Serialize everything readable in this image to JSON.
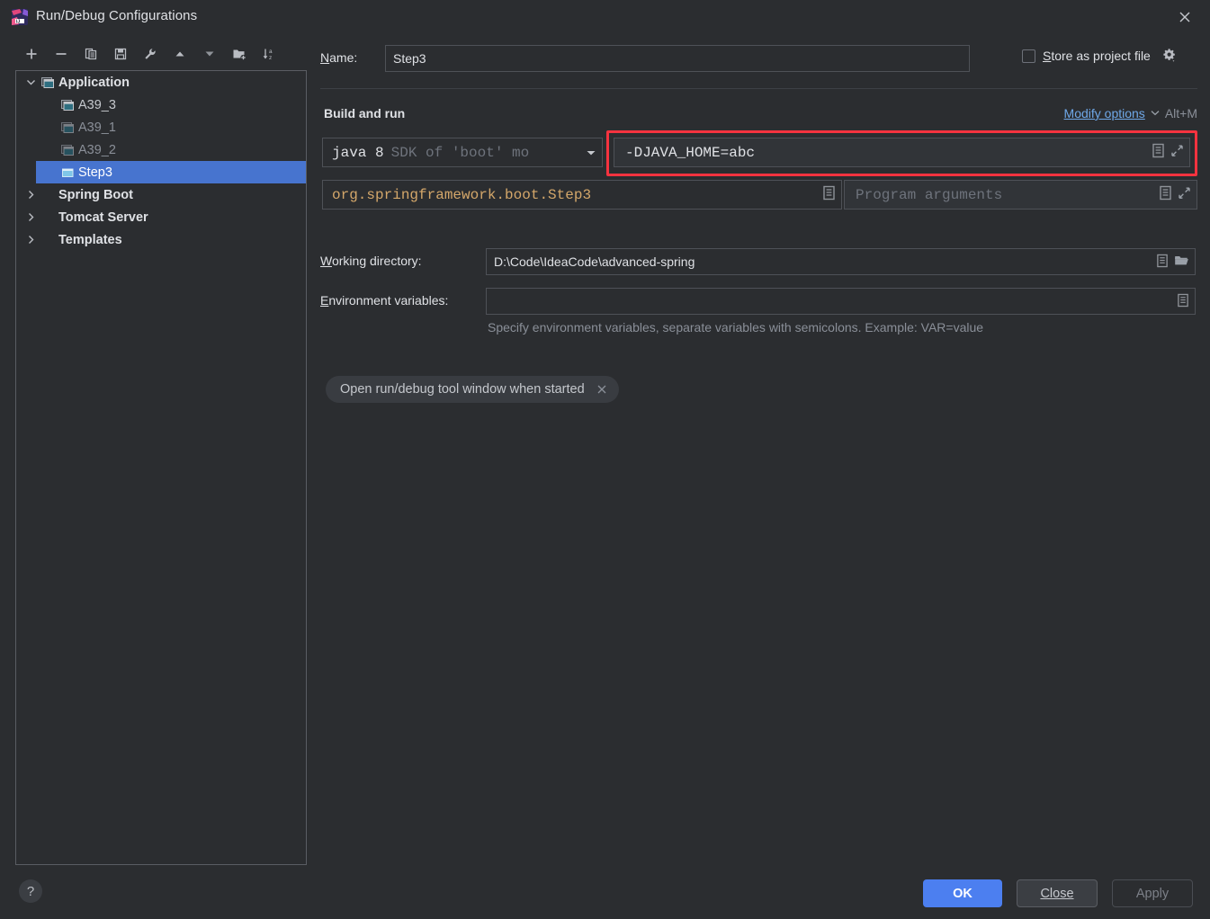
{
  "window": {
    "title": "Run/Debug Configurations",
    "logo_icon": "intellij-idea-logo",
    "close_icon": "close-icon"
  },
  "toolbar": {
    "buttons": [
      {
        "name": "add-configuration-button",
        "icon": "plus-icon"
      },
      {
        "name": "remove-configuration-button",
        "icon": "minus-icon"
      },
      {
        "name": "copy-configuration-button",
        "icon": "copy-icon"
      },
      {
        "name": "save-configuration-button",
        "icon": "save-icon"
      },
      {
        "name": "edit-templates-button",
        "icon": "wrench-icon"
      },
      {
        "name": "move-up-button",
        "icon": "arrow-up-icon"
      },
      {
        "name": "move-down-button",
        "icon": "arrow-down-icon"
      },
      {
        "name": "new-folder-button",
        "icon": "new-folder-icon"
      },
      {
        "name": "sort-configurations-button",
        "icon": "sort-az-icon"
      }
    ]
  },
  "tree": {
    "items": [
      {
        "label": "Application",
        "level": 0,
        "twisty": "expanded",
        "icon": "application-icon",
        "style": "bold",
        "selected": false
      },
      {
        "label": "A39_3",
        "level": 1,
        "twisty": "none",
        "icon": "application-icon",
        "style": "child",
        "selected": false
      },
      {
        "label": "A39_1",
        "level": 1,
        "twisty": "none",
        "icon": "application-icon-dim",
        "style": "dim",
        "selected": false
      },
      {
        "label": "A39_2",
        "level": 1,
        "twisty": "none",
        "icon": "application-icon-dim",
        "style": "dim",
        "selected": false
      },
      {
        "label": "Step3",
        "level": 1,
        "twisty": "none",
        "icon": "application-icon-sel",
        "style": "sel",
        "selected": true
      },
      {
        "label": "Spring Boot",
        "level": 0,
        "twisty": "collapsed",
        "icon": "spring-boot-icon",
        "style": "bold",
        "selected": false
      },
      {
        "label": "Tomcat Server",
        "level": 0,
        "twisty": "collapsed",
        "icon": "tomcat-icon",
        "style": "bold",
        "selected": false
      },
      {
        "label": "Templates",
        "level": 0,
        "twisty": "collapsed",
        "icon": "wrench-icon",
        "style": "bold",
        "selected": false
      }
    ]
  },
  "form": {
    "name_label": "Name:",
    "name_value": "Step3",
    "store_as_project_file_label": "Store as project file",
    "store_as_project_file_checked": false,
    "store_gear_icon": "gear-icon",
    "section_title": "Build and run",
    "modify_options_label": "Modify options",
    "modify_options_shortcut": "Alt+M",
    "jdk_primary": "java 8",
    "jdk_secondary": "SDK of 'boot' mo",
    "vm_options_value": "-DJAVA_HOME=abc",
    "main_class_value": "org.springframework.boot.Step3",
    "program_arguments_placeholder": "Program arguments",
    "working_directory_label": "Working directory:",
    "working_directory_value": "D:\\Code\\IdeaCode\\advanced-spring",
    "environment_variables_label": "Environment variables:",
    "environment_variables_value": "",
    "environment_hint": "Specify environment variables, separate variables with semicolons. Example: VAR=value",
    "chip_label": "Open run/debug tool window when started",
    "chip_close_icon": "close-icon",
    "macro_icon": "macro-list-icon",
    "expand_icon": "expand-icon",
    "folder_icon": "open-folder-icon"
  },
  "footer": {
    "help_label": "?",
    "ok_label": "OK",
    "close_label": "Close",
    "apply_label": "Apply",
    "apply_enabled": false
  },
  "colors": {
    "background": "#2b2d30",
    "selection": "#4774cf",
    "accent_button": "#4c7ff0",
    "link": "#6fa8e8",
    "highlight_border": "#f5333f",
    "main_class_text": "#d4a76a",
    "placeholder": "#6e737c"
  }
}
